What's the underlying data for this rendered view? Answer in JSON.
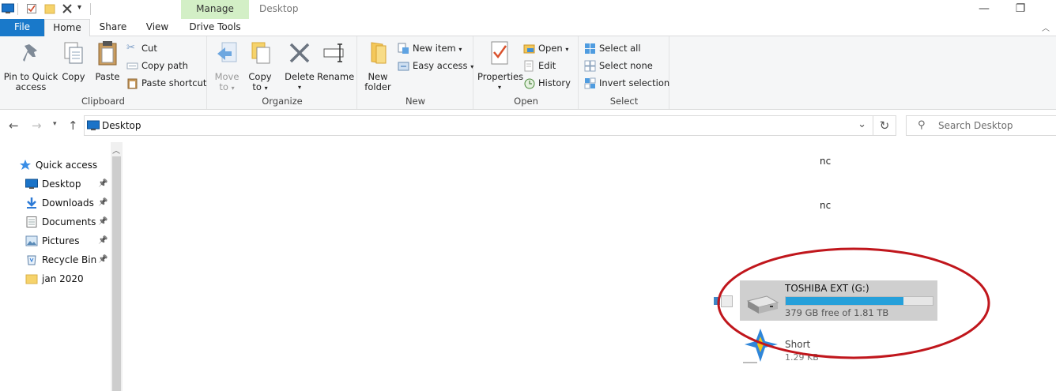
{
  "window": {
    "title": "Desktop",
    "contextual_tab_group": "Manage",
    "controls": {
      "minimize": "—",
      "maximize": "❐"
    }
  },
  "tabs": [
    "File",
    "Home",
    "Share",
    "View",
    "Drive Tools"
  ],
  "ribbon": {
    "clipboard": {
      "label": "Clipboard",
      "pin_to_quick_access": [
        "Pin to Quick",
        "access"
      ],
      "copy": "Copy",
      "paste": "Paste",
      "cut": "Cut",
      "copy_path": "Copy path",
      "paste_shortcut": "Paste shortcut"
    },
    "organize": {
      "label": "Organize",
      "move_to": [
        "Move",
        "to"
      ],
      "copy_to": [
        "Copy",
        "to"
      ],
      "delete": "Delete",
      "rename": "Rename"
    },
    "new": {
      "label": "New",
      "new_folder": [
        "New",
        "folder"
      ],
      "new_item": "New item",
      "easy_access": "Easy access"
    },
    "open": {
      "label": "Open",
      "properties": "Properties",
      "open": "Open",
      "edit": "Edit",
      "history": "History"
    },
    "select": {
      "label": "Select",
      "select_all": "Select all",
      "select_none": "Select none",
      "invert_selection": "Invert selection"
    }
  },
  "address": {
    "path": "Desktop",
    "search_placeholder": "Search Desktop"
  },
  "nav_pane": {
    "quick_access": "Quick access",
    "items": [
      {
        "label": "Desktop",
        "icon": "desktop-icon",
        "pinned": true
      },
      {
        "label": "Downloads",
        "icon": "download-icon",
        "pinned": true
      },
      {
        "label": "Documents",
        "icon": "document-icon",
        "pinned": true
      },
      {
        "label": "Pictures",
        "icon": "pictures-icon",
        "pinned": true
      },
      {
        "label": "Recycle Bin",
        "icon": "recycle-bin-icon",
        "pinned": true
      },
      {
        "label": "jan 2020",
        "icon": "folder-icon",
        "pinned": false
      }
    ]
  },
  "content": {
    "fragments": [
      "nc",
      "nc"
    ],
    "drive": {
      "name": "TOSHIBA EXT (G:)",
      "free_text": "379 GB free of 1.81 TB",
      "used_fraction": 0.8,
      "bar_color": "#26a0da"
    },
    "shortcut": {
      "name": "Short",
      "size": "1.29 KB"
    },
    "annotation_color": "#c0161c"
  }
}
